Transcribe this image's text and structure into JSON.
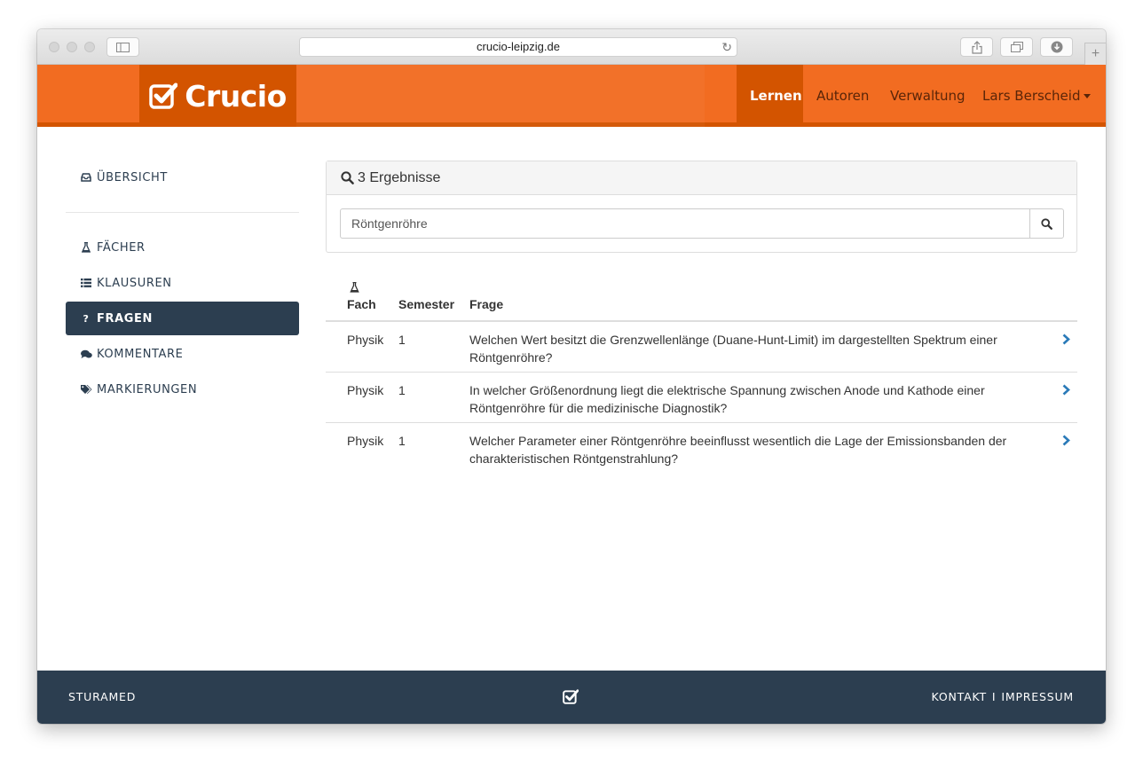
{
  "browser": {
    "url": "crucio-leipzig.de"
  },
  "navbar": {
    "brand": "Crucio",
    "items": [
      {
        "label": "Lernen",
        "active": true
      },
      {
        "label": "Autoren",
        "active": false
      },
      {
        "label": "Verwaltung",
        "active": false
      },
      {
        "label": "Lars Berscheid",
        "active": false
      }
    ]
  },
  "sidebar": {
    "items": [
      {
        "label": "ÜBERSICHT",
        "icon": "inbox-icon"
      },
      {
        "label": "FÄCHER",
        "icon": "flask-icon"
      },
      {
        "label": "KLAUSUREN",
        "icon": "list-icon"
      },
      {
        "label": "FRAGEN",
        "icon": "question-icon",
        "active": true
      },
      {
        "label": "KOMMENTARE",
        "icon": "comments-icon"
      },
      {
        "label": "MARKIERUNGEN",
        "icon": "tags-icon"
      }
    ]
  },
  "search": {
    "heading": "3 Ergebnisse",
    "value": "Röntgenröhre"
  },
  "table": {
    "headers": [
      "Fach",
      "Semester",
      "Frage"
    ],
    "rows": [
      {
        "fach": "Physik",
        "semester": "1",
        "frage": "Welchen Wert besitzt die Grenzwellenlänge (Duane-Hunt-Limit) im dargestellten Spektrum einer Röntgenröhre?"
      },
      {
        "fach": "Physik",
        "semester": "1",
        "frage": "In welcher Größenordnung liegt die elektrische Spannung zwischen Anode und Kathode einer Röntgenröhre für die medizinische Diagnostik?"
      },
      {
        "fach": "Physik",
        "semester": "1",
        "frage": "Welcher Parameter einer Röntgenröhre beeinflusst wesentlich die Lage der Emissionsbanden der charakteristischen Röntgenstrahlung?"
      }
    ]
  },
  "footer": {
    "left": "STURAMED",
    "contact": "KONTAKT",
    "separator": "I",
    "imprint": "IMPRESSUM"
  },
  "colors": {
    "primary": "#f26c21",
    "primary_dark": "#d35400",
    "navy": "#2c3e50",
    "link": "#2a7ab8"
  }
}
